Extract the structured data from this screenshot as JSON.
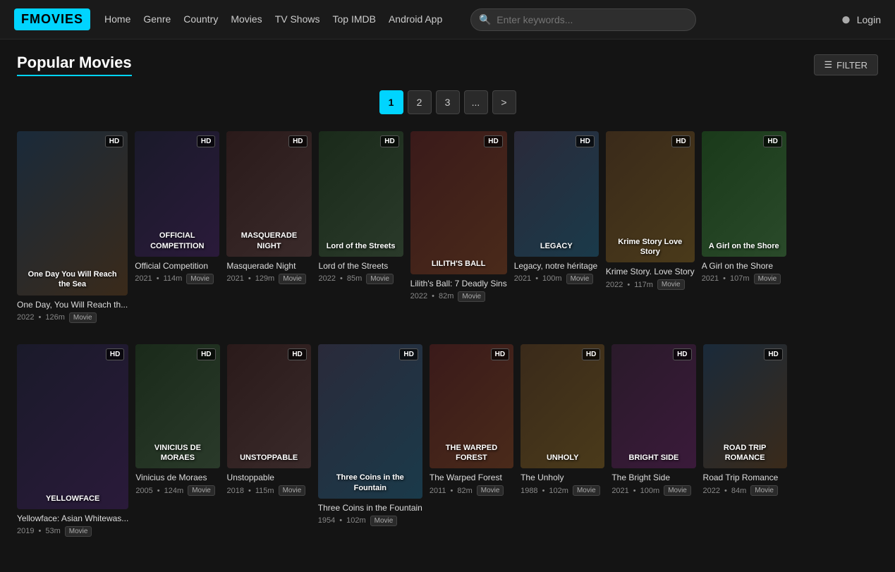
{
  "brand": {
    "logo": "FMOVIES"
  },
  "navbar": {
    "links": [
      {
        "label": "Home",
        "id": "home"
      },
      {
        "label": "Genre",
        "id": "genre"
      },
      {
        "label": "Country",
        "id": "country"
      },
      {
        "label": "Movies",
        "id": "movies"
      },
      {
        "label": "TV Shows",
        "id": "tv-shows"
      },
      {
        "label": "Top IMDB",
        "id": "top-imdb"
      },
      {
        "label": "Android App",
        "id": "android-app"
      }
    ],
    "search_placeholder": "Enter keywords...",
    "login_label": "Login"
  },
  "page": {
    "title": "Popular Movies",
    "filter_label": "FILTER"
  },
  "pagination": {
    "pages": [
      "1",
      "2",
      "3",
      "...",
      ">"
    ],
    "active": "1"
  },
  "movies_row1": [
    {
      "title": "One Day, You Will Reach th...",
      "year": "2022",
      "duration": "126m",
      "type": "Movie",
      "badge": "HD",
      "bg": "poster-bg-1",
      "overlay": "One Day You Will Reach the Sea"
    },
    {
      "title": "Official Competition",
      "year": "2021",
      "duration": "114m",
      "type": "Movie",
      "badge": "HD",
      "bg": "poster-bg-2",
      "overlay": "OFFICIAL COMPETITION"
    },
    {
      "title": "Masquerade Night",
      "year": "2021",
      "duration": "129m",
      "type": "Movie",
      "badge": "HD",
      "bg": "poster-bg-3",
      "overlay": "MASQUERADE NIGHT"
    },
    {
      "title": "Lord of the Streets",
      "year": "2022",
      "duration": "85m",
      "type": "Movie",
      "badge": "HD",
      "bg": "poster-bg-4",
      "overlay": "Lord of the Streets"
    },
    {
      "title": "Lilith's Ball: 7 Deadly Sins",
      "year": "2022",
      "duration": "82m",
      "type": "Movie",
      "badge": "HD",
      "bg": "poster-bg-5",
      "overlay": "LILITH'S BALL"
    },
    {
      "title": "Legacy, notre héritage",
      "year": "2021",
      "duration": "100m",
      "type": "Movie",
      "badge": "HD",
      "bg": "poster-bg-6",
      "overlay": "LEGACY"
    },
    {
      "title": "Krime Story. Love Story",
      "year": "2022",
      "duration": "117m",
      "type": "Movie",
      "badge": "HD",
      "bg": "poster-bg-7",
      "overlay": "Krime Story Love Story"
    },
    {
      "title": "A Girl on the Shore",
      "year": "2021",
      "duration": "107m",
      "type": "Movie",
      "badge": "HD",
      "bg": "poster-bg-8",
      "overlay": "A Girl on the Shore"
    }
  ],
  "movies_row2": [
    {
      "title": "Yellowface: Asian Whitewas...",
      "year": "2019",
      "duration": "53m",
      "type": "Movie",
      "badge": "HD",
      "bg": "poster-bg-2",
      "overlay": "YELLOWFACE"
    },
    {
      "title": "Vinicius de Moraes",
      "year": "2005",
      "duration": "124m",
      "type": "Movie",
      "badge": "HD",
      "bg": "poster-bg-4",
      "overlay": "VINICIUS DE MORAES"
    },
    {
      "title": "Unstoppable",
      "year": "2018",
      "duration": "115m",
      "type": "Movie",
      "badge": "HD",
      "bg": "poster-bg-3",
      "overlay": "UNSTOPPABLE"
    },
    {
      "title": "Three Coins in the Fountain",
      "year": "1954",
      "duration": "102m",
      "type": "Movie",
      "badge": "HD",
      "bg": "poster-bg-6",
      "overlay": "Three Coins in the Fountain"
    },
    {
      "title": "The Warped Forest",
      "year": "2011",
      "duration": "82m",
      "type": "Movie",
      "badge": "HD",
      "bg": "poster-bg-5",
      "overlay": "THE WARPED FOREST"
    },
    {
      "title": "The Unholy",
      "year": "1988",
      "duration": "102m",
      "type": "Movie",
      "badge": "HD",
      "bg": "poster-bg-7",
      "overlay": "UNHOLY"
    },
    {
      "title": "The Bright Side",
      "year": "2021",
      "duration": "100m",
      "type": "Movie",
      "badge": "HD",
      "bg": "poster-bg-9",
      "overlay": "BRIGHT SIDE"
    },
    {
      "title": "Road Trip Romance",
      "year": "2022",
      "duration": "84m",
      "type": "Movie",
      "badge": "HD",
      "bg": "poster-bg-1",
      "overlay": "ROAD TRIP ROMANCE"
    }
  ]
}
